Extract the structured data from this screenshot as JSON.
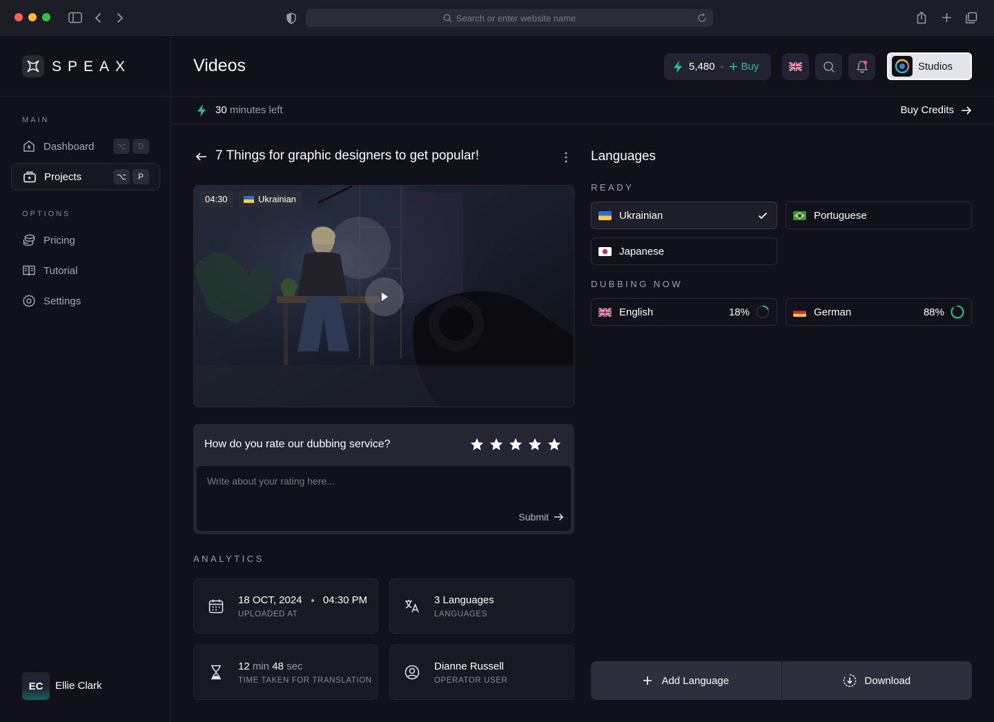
{
  "browser": {
    "url_placeholder": "Search or enter website name"
  },
  "brand": {
    "name": "SPEAX"
  },
  "sidebar": {
    "main_label": "MAIN",
    "options_label": "OPTIONS",
    "items": [
      {
        "label": "Dashboard",
        "icon": "home-icon",
        "shortcut": [
          "⌥",
          "D"
        ]
      },
      {
        "label": "Projects",
        "icon": "projects-icon",
        "shortcut": [
          "⌥",
          "P"
        ]
      },
      {
        "label": "Pricing",
        "icon": "coins-icon"
      },
      {
        "label": "Tutorial",
        "icon": "book-icon"
      },
      {
        "label": "Settings",
        "icon": "gear-icon"
      }
    ],
    "user": {
      "initials": "EC",
      "name": "Ellie Clark"
    }
  },
  "header": {
    "title": "Videos",
    "credits": "5,480",
    "buy_label": "Buy",
    "studio_label": "Studios"
  },
  "subbar": {
    "minutes": "30",
    "minutes_suffix": "minutes left",
    "buy_credits": "Buy Credits"
  },
  "video": {
    "title": "7 Things for graphic designers to get popular!",
    "duration": "04:30",
    "language": "Ukrainian"
  },
  "rating": {
    "question": "How do you rate our dubbing service?",
    "stars_total": 5,
    "placeholder": "Write about your rating here...",
    "submit": "Submit"
  },
  "analytics": {
    "label": "ANALYTICS",
    "cards": [
      {
        "icon": "calendar-icon",
        "main_a": "18 OCT, 2024",
        "main_b": "04:30 PM",
        "sub": "UPLOADED AT"
      },
      {
        "icon": "translate-icon",
        "main_a": "3 Languages",
        "sub": "LANGUAGES"
      },
      {
        "icon": "hourglass-icon",
        "num1": "12",
        "unit1": "min",
        "num2": "48",
        "unit2": "sec",
        "sub": "TIME TAKEN FOR TRANSLATION"
      },
      {
        "icon": "user-circle-icon",
        "main_a": "Dianne Russell",
        "sub": "OPERATOR USER"
      }
    ]
  },
  "languages": {
    "title": "Languages",
    "ready_label": "READY",
    "dubbing_label": "DUBBING NOW",
    "ready": [
      {
        "name": "Ukrainian",
        "selected": true
      },
      {
        "name": "Portuguese"
      },
      {
        "name": "Japanese"
      }
    ],
    "dubbing": [
      {
        "name": "English",
        "percent": "18%",
        "progress": 0.18
      },
      {
        "name": "German",
        "percent": "88%",
        "progress": 0.88
      }
    ],
    "add_label": "Add Language",
    "download_label": "Download"
  },
  "colors": {
    "accent": "#22c3a6",
    "bg": "#111119",
    "card": "#191922"
  }
}
